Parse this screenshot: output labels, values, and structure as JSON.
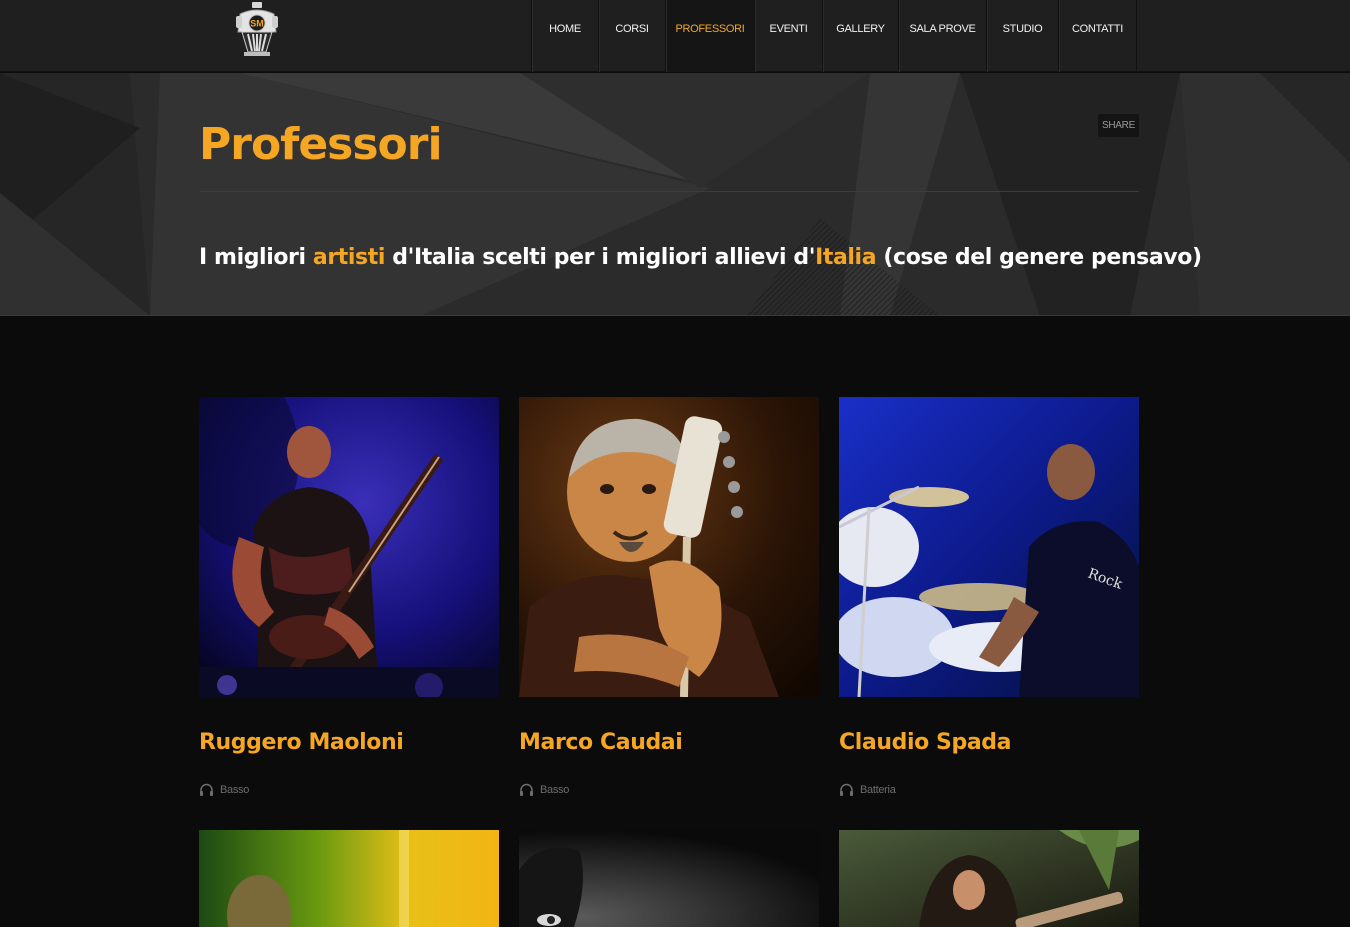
{
  "header": {
    "logo_text": "SM",
    "nav": [
      {
        "label": "HOME",
        "width": 67
      },
      {
        "label": "CORSI",
        "width": 67
      },
      {
        "label": "PROFESSORI",
        "width": 89,
        "active": true
      },
      {
        "label": "EVENTI",
        "width": 68
      },
      {
        "label": "GALLERY",
        "width": 76
      },
      {
        "label": "SALA PROVE",
        "width": 88
      },
      {
        "label": "STUDIO",
        "width": 72
      },
      {
        "label": "CONTATTI",
        "width": 79
      }
    ]
  },
  "hero": {
    "title": "Professori",
    "share_label": "SHARE",
    "tagline": {
      "part1": "I migliori ",
      "hl1": "artisti",
      "part2": " d'Italia scelti per i migliori allievi d'",
      "hl2": "Italia",
      "part3": " (cose del genere pensavo)"
    }
  },
  "professors": [
    {
      "name": "Ruggero Maoloni",
      "instrument": "Basso"
    },
    {
      "name": "Marco Caudai",
      "instrument": "Basso"
    },
    {
      "name": "Claudio Spada",
      "instrument": "Batteria"
    }
  ],
  "colors": {
    "accent": "#f5a623",
    "nav_bg": "#1f1f1f",
    "hero_bg": "#2a2a2a",
    "page_bg": "#0b0b0b"
  },
  "icons": {
    "instrument": "headphones-icon"
  }
}
